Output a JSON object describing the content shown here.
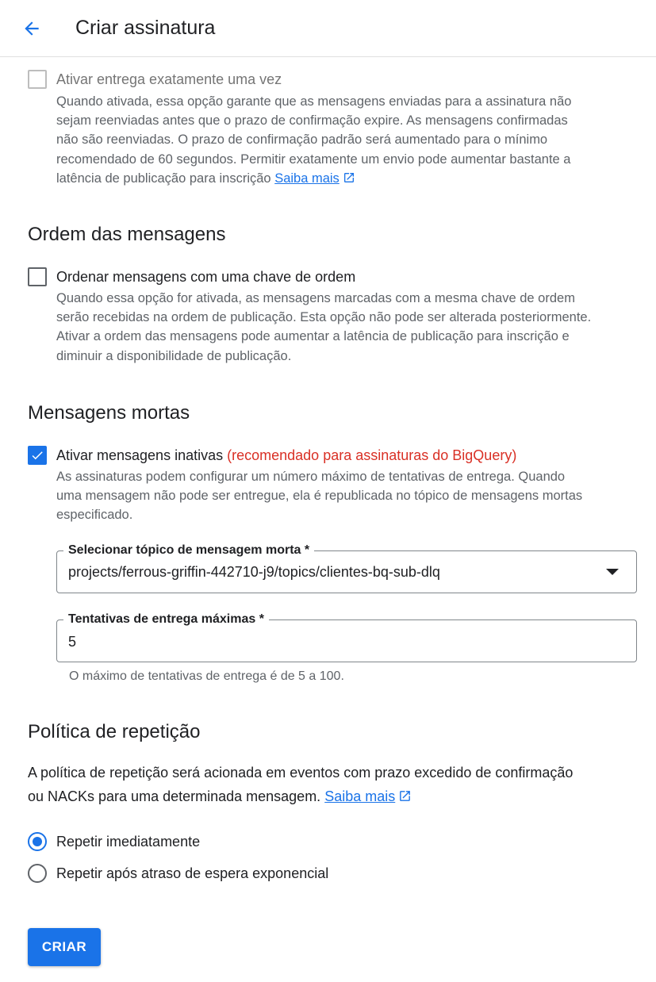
{
  "header": {
    "back_icon": "arrow-back-icon",
    "title": "Criar assinatura"
  },
  "exactly_once": {
    "label": "Ativar entrega exatamente uma vez",
    "enabled": false,
    "checked": false,
    "desc_lines": [
      "Quando ativada, essa opção garante que as mensagens enviadas para a assinatura não",
      "sejam reenviadas antes que o prazo de confirmação expire. As mensagens confirmadas",
      "não são reenviadas. O prazo de confirmação padrão será aumentado para o mínimo",
      "recomendado de 60 segundos. Permitir exatamente um envio pode aumentar bastante a",
      "latência de publicação para inscrição"
    ],
    "link": "Saiba mais"
  },
  "ordering": {
    "title": "Ordem das mensagens",
    "label": "Ordenar mensagens com uma chave de ordem",
    "checked": false,
    "desc_lines": [
      "Quando essa opção for ativada, as mensagens marcadas com a mesma chave de ordem",
      "serão recebidas na ordem de publicação. Esta opção não pode ser alterada posteriormente.",
      "Ativar a ordem das mensagens pode aumentar a latência de publicação para inscrição e",
      "diminuir a disponibilidade de publicação."
    ]
  },
  "dead_letter": {
    "title": "Mensagens mortas",
    "label": "Ativar mensagens inativas",
    "label_note": "(recomendado para assinaturas do BigQuery)",
    "checked": true,
    "desc_lines": [
      "As assinaturas podem configurar um número máximo de tentativas de entrega. Quando",
      "uma mensagem não pode ser entregue, ela é republicada no tópico de mensagens mortas",
      "especificado."
    ],
    "topic_field": {
      "label": "Selecionar tópico de mensagem morta *",
      "value": "projects/ferrous-griffin-442710-j9/topics/clientes-bq-sub-dlq"
    },
    "attempts_field": {
      "label": "Tentativas de entrega máximas *",
      "value": "5",
      "hint": "O máximo de tentativas de entrega é de 5 a 100."
    }
  },
  "retry": {
    "title": "Política de repetição",
    "desc_line1": "A política de repetição será acionada em eventos com prazo excedido de confirmação",
    "desc_line2": "ou NACKs para uma determinada mensagem.",
    "link": "Saiba mais",
    "options": [
      {
        "label": "Repetir imediatamente",
        "selected": true
      },
      {
        "label": "Repetir após atraso de espera exponencial",
        "selected": false
      }
    ]
  },
  "actions": {
    "create_label": "CRIAR"
  },
  "colors": {
    "accent": "#1a73e8",
    "warning_text": "#d93025",
    "muted_text": "#5f6368"
  }
}
